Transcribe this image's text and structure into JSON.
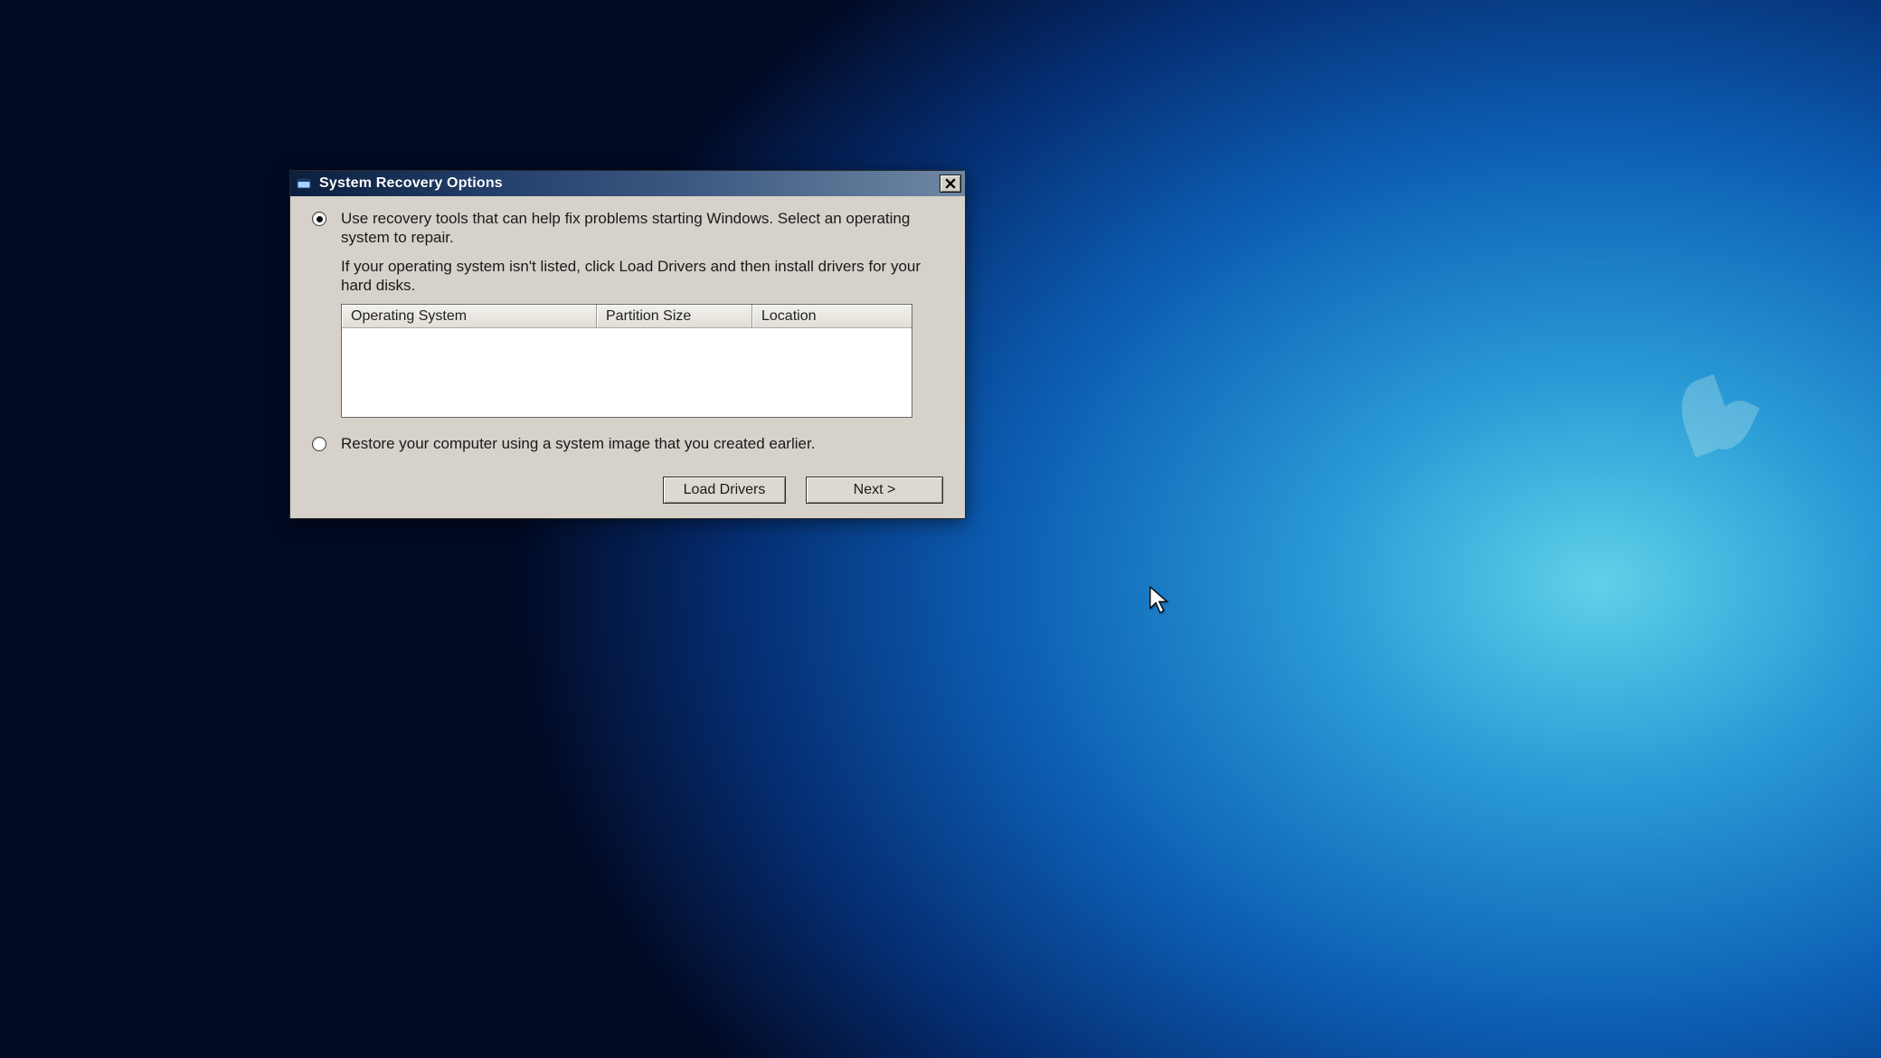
{
  "window": {
    "title": "System Recovery Options"
  },
  "option1": {
    "line1": "Use recovery tools that can help fix problems starting Windows. Select an operating system to repair.",
    "line2": "If your operating system isn't listed, click Load Drivers and then install drivers for your hard disks.",
    "selected": true
  },
  "listview": {
    "columns": {
      "os": "Operating System",
      "partition": "Partition Size",
      "location": "Location"
    },
    "rows": []
  },
  "option2": {
    "text": "Restore your computer using a system image that you created earlier.",
    "selected": false
  },
  "buttons": {
    "load_drivers": "Load Drivers",
    "next": "Next >"
  }
}
